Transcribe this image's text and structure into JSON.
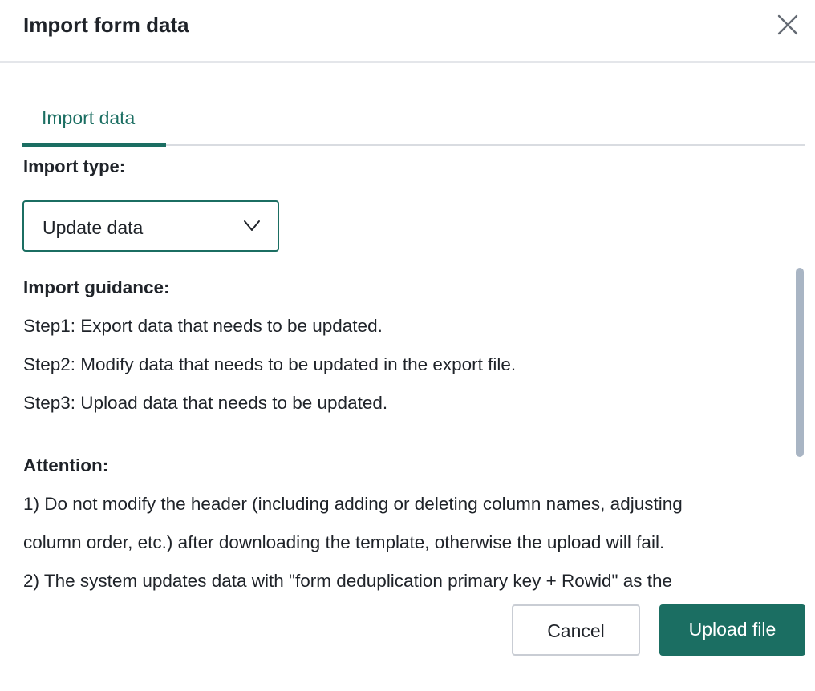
{
  "dialog": {
    "title": "Import form data",
    "close_icon": "close-icon"
  },
  "tabs": [
    {
      "label": "Import data",
      "active": true
    }
  ],
  "import_type": {
    "label": "Import type:",
    "selected": "Update data",
    "chevron_icon": "chevron-down-icon"
  },
  "guidance": {
    "heading": "Import guidance:",
    "steps": [
      "Step1: Export data that needs to be updated.",
      "Step2: Modify data that needs to be updated in the export file.",
      "Step3: Upload data that needs to be updated."
    ],
    "attention_heading": "Attention:",
    "attention_lines": [
      "1) Do not modify the header (including adding or deleting column names, adjusting",
      "column order, etc.) after downloading the template, otherwise the upload will fail.",
      "2) The system updates data with \"form deduplication primary key + Rowid\" as the"
    ]
  },
  "footer": {
    "cancel_label": "Cancel",
    "upload_label": "Upload file"
  },
  "colors": {
    "accent": "#1b6e62",
    "text": "#1f2329",
    "divider": "#e4e6ea",
    "scrollbar": "#a9b5c4"
  }
}
